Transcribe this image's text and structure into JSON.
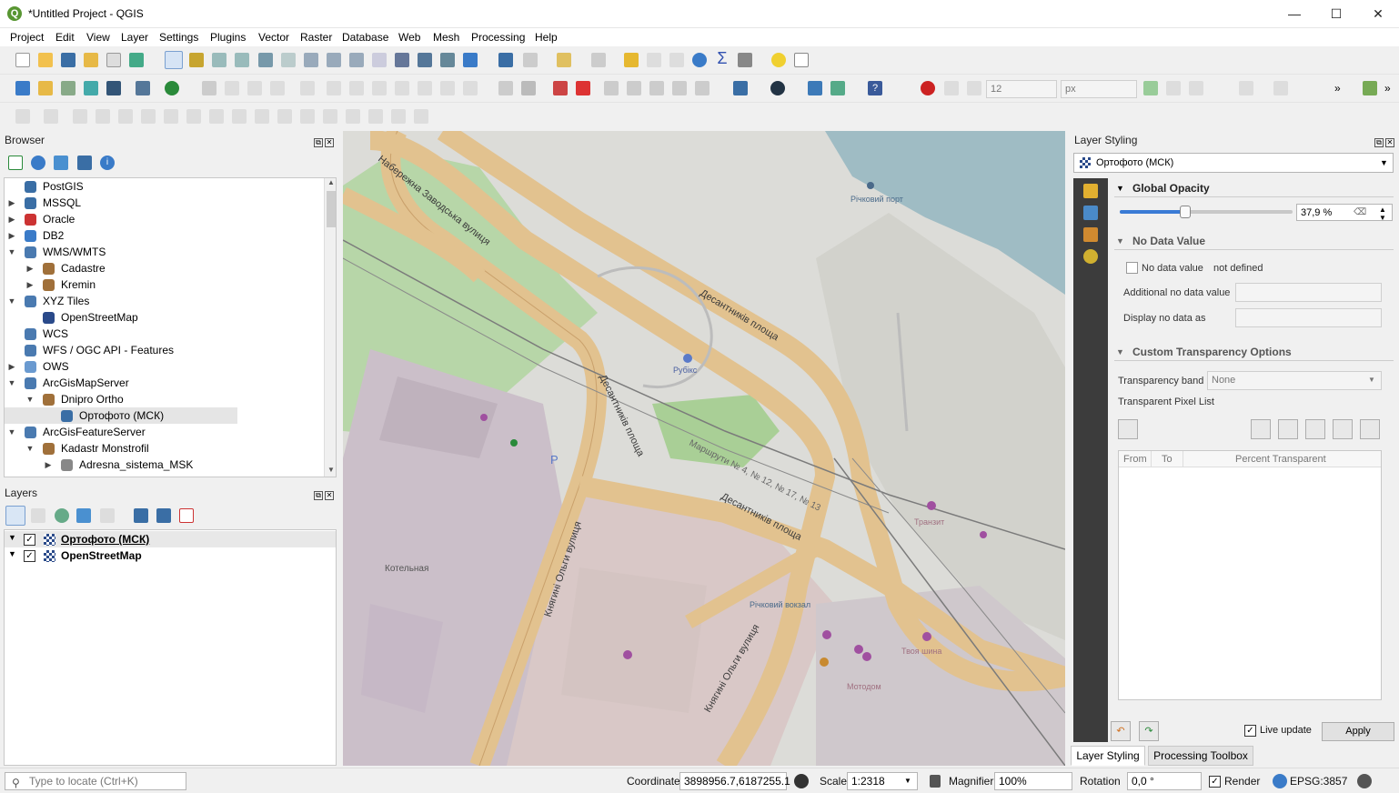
{
  "window": {
    "title": "*Untitled Project - QGIS"
  },
  "menu": [
    "Project",
    "Edit",
    "View",
    "Layer",
    "Settings",
    "Plugins",
    "Vector",
    "Raster",
    "Database",
    "Web",
    "Mesh",
    "Processing",
    "Help"
  ],
  "toolbar": {
    "font_size": "12",
    "unit": "px"
  },
  "browser": {
    "title": "Browser",
    "items": [
      {
        "label": "PostGIS",
        "level": 0,
        "expand": ""
      },
      {
        "label": "MSSQL",
        "level": 0,
        "expand": "▶"
      },
      {
        "label": "Oracle",
        "level": 0,
        "expand": "▶"
      },
      {
        "label": "DB2",
        "level": 0,
        "expand": "▶"
      },
      {
        "label": "WMS/WMTS",
        "level": 0,
        "expand": "▼"
      },
      {
        "label": "Cadastre",
        "level": 1,
        "expand": "▶"
      },
      {
        "label": "Kremin",
        "level": 1,
        "expand": "▶"
      },
      {
        "label": "XYZ Tiles",
        "level": 0,
        "expand": "▼"
      },
      {
        "label": "OpenStreetMap",
        "level": 1,
        "expand": ""
      },
      {
        "label": "WCS",
        "level": 0,
        "expand": ""
      },
      {
        "label": "WFS / OGC API - Features",
        "level": 0,
        "expand": ""
      },
      {
        "label": "OWS",
        "level": 0,
        "expand": "▶"
      },
      {
        "label": "ArcGisMapServer",
        "level": 0,
        "expand": "▼"
      },
      {
        "label": "Dnipro Ortho",
        "level": 1,
        "expand": "▼"
      },
      {
        "label": "Ортофото (МСК)",
        "level": 2,
        "expand": ""
      },
      {
        "label": "ArcGisFeatureServer",
        "level": 0,
        "expand": "▼"
      },
      {
        "label": "Kadastr Monstrofil",
        "level": 1,
        "expand": "▼"
      },
      {
        "label": "Adresna_sistema_MSK",
        "level": 2,
        "expand": "▶"
      }
    ]
  },
  "layers": {
    "title": "Layers",
    "items": [
      {
        "label": "Ортофото (МСК)",
        "checked": "✓"
      },
      {
        "label": "OpenStreetMap",
        "checked": "✓"
      }
    ]
  },
  "map": {
    "labels": [
      "Набережна Заводська вулиця",
      "Десантників площа",
      "Десантників площа",
      "Десантників площа",
      "Княгині Ольги вулиця",
      "Княгині Ольги вулиця",
      "Маршрути № 4, № 12, № 17, № 13",
      "Рубікс",
      "Річковий порт",
      "Котельная",
      "Транзит",
      "Річковий вокзал",
      "Твоя шина",
      "Мотодом",
      "P"
    ]
  },
  "styling": {
    "title": "Layer Styling",
    "layer": "Ортофото (МСК)",
    "global_opacity_label": "Global Opacity",
    "opacity_value": "37,9 %",
    "opacity_fraction": 0.379,
    "no_data_label": "No Data Value",
    "no_data_check": "No data value",
    "not_defined": "not defined",
    "additional_no_data": "Additional no data value",
    "display_no_data": "Display no data as",
    "custom_transparency": "Custom Transparency Options",
    "transparency_band_label": "Transparency band",
    "transparency_band_value": "None",
    "pixel_list_label": "Transparent Pixel List",
    "columns": [
      "From",
      "To",
      "Percent Transparent"
    ],
    "live_update": "Live update",
    "apply": "Apply"
  },
  "tabs": [
    "Layer Styling",
    "Processing Toolbox"
  ],
  "statusbar": {
    "locate_placeholder": "Type to locate (Ctrl+K)",
    "coordinate_label": "Coordinate",
    "coordinate_value": "3898956.7,6187255.1",
    "scale_label": "Scale",
    "scale_value": "1:2318",
    "magnifier_label": "Magnifier",
    "magnifier_value": "100%",
    "rotation_label": "Rotation",
    "rotation_value": "0,0 °",
    "render_label": "Render",
    "crs": "EPSG:3857"
  }
}
